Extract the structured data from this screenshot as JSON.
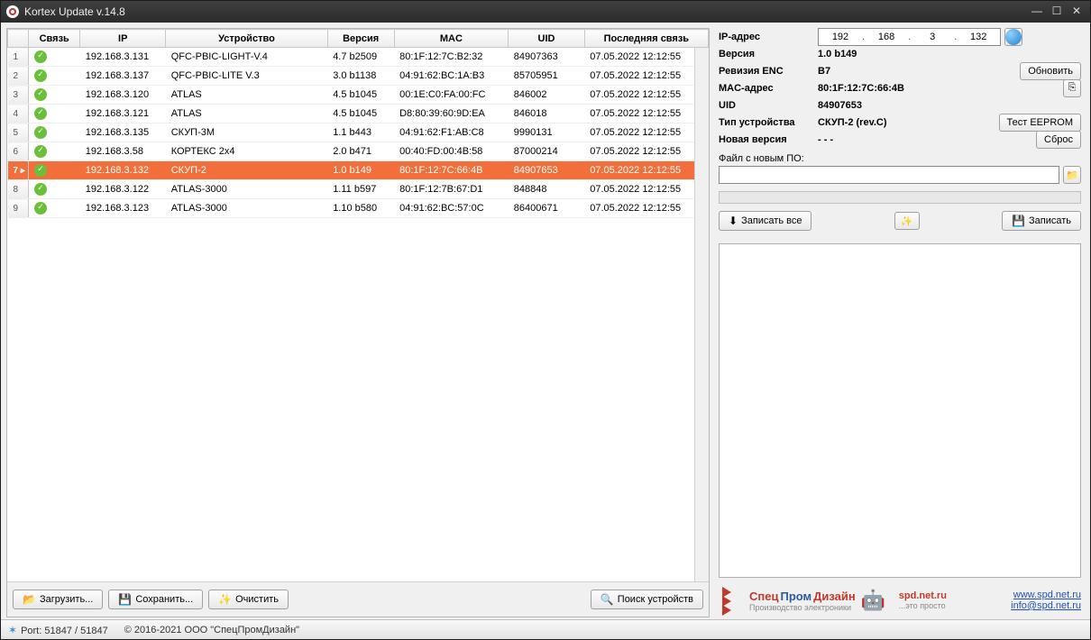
{
  "window": {
    "title": "Kortex Update v.14.8"
  },
  "table": {
    "headers": {
      "conn": "Связь",
      "ip": "IP",
      "device": "Устройство",
      "version": "Версия",
      "mac": "MAC",
      "uid": "UID",
      "last": "Последняя связь"
    },
    "rows": [
      {
        "n": "1",
        "ip": "192.168.3.131",
        "device": "QFC-PBIC-LIGHT-V.4",
        "version": "4.7 b2509",
        "mac": "80:1F:12:7C:B2:32",
        "uid": "84907363",
        "last": "07.05.2022 12:12:55"
      },
      {
        "n": "2",
        "ip": "192.168.3.137",
        "device": "QFC-PBIC-LITE V.3",
        "version": "3.0 b1138",
        "mac": "04:91:62:BC:1A:B3",
        "uid": "85705951",
        "last": "07.05.2022 12:12:55"
      },
      {
        "n": "3",
        "ip": "192.168.3.120",
        "device": "ATLAS",
        "version": "4.5 b1045",
        "mac": "00:1E:C0:FA:00:FC",
        "uid": "846002",
        "last": "07.05.2022 12:12:55"
      },
      {
        "n": "4",
        "ip": "192.168.3.121",
        "device": "ATLAS",
        "version": "4.5 b1045",
        "mac": "D8:80:39:60:9D:EA",
        "uid": "846018",
        "last": "07.05.2022 12:12:55"
      },
      {
        "n": "5",
        "ip": "192.168.3.135",
        "device": "СКУП-3М",
        "version": "1.1 b443",
        "mac": "04:91:62:F1:AB:C8",
        "uid": "9990131",
        "last": "07.05.2022 12:12:55"
      },
      {
        "n": "6",
        "ip": "192.168.3.58",
        "device": "КОРТЕКС 2x4",
        "version": "2.0 b471",
        "mac": "00:40:FD:00:4B:58",
        "uid": "87000214",
        "last": "07.05.2022 12:12:55"
      },
      {
        "n": "7",
        "ip": "192.168.3.132",
        "device": "СКУП-2",
        "version": "1.0 b149",
        "mac": "80:1F:12:7C:66:4B",
        "uid": "84907653",
        "last": "07.05.2022 12:12:55",
        "selected": true
      },
      {
        "n": "8",
        "ip": "192.168.3.122",
        "device": "ATLAS-3000",
        "version": "1.11 b597",
        "mac": "80:1F:12:7B:67:D1",
        "uid": "848848",
        "last": "07.05.2022 12:12:55"
      },
      {
        "n": "9",
        "ip": "192.168.3.123",
        "device": "ATLAS-3000",
        "version": "1.10 b580",
        "mac": "04:91:62:BC:57:0C",
        "uid": "86400671",
        "last": "07.05.2022 12:12:55"
      }
    ]
  },
  "buttons": {
    "load": "Загрузить...",
    "save": "Сохранить...",
    "clear": "Очистить",
    "search": "Поиск устройств",
    "refresh": "Обновить",
    "test": "Тест EEPROM",
    "reset": "Сброс",
    "write_all": "Записать все",
    "write": "Записать"
  },
  "detail": {
    "labels": {
      "ip": "IP-адрес",
      "version": "Версия",
      "rev": "Ревизия ENC",
      "mac": "MAC-адрес",
      "uid": "UID",
      "type": "Тип устройства",
      "newver": "Новая версия",
      "file": "Файл с новым ПО:"
    },
    "ip": {
      "a": "192",
      "b": "168",
      "c": "3",
      "d": "132"
    },
    "version": "1.0 b149",
    "rev": "B7",
    "mac": "80:1F:12:7C:66:4B",
    "uid": "84907653",
    "type": "СКУП-2 (rev.C)",
    "newver": "- - -",
    "file": ""
  },
  "branding": {
    "name1": "Спец",
    "name2": "Пром",
    "name3": "Дизайн",
    "sub": "Производство электроники",
    "site_label": "spd.net.ru",
    "tagline": "...это просто",
    "url": "www.spd.net.ru",
    "email": "info@spd.net.ru"
  },
  "status": {
    "port": "Port: 51847 / 51847",
    "copyright": "© 2016-2021 ООО \"СпецПромДизайн\""
  }
}
